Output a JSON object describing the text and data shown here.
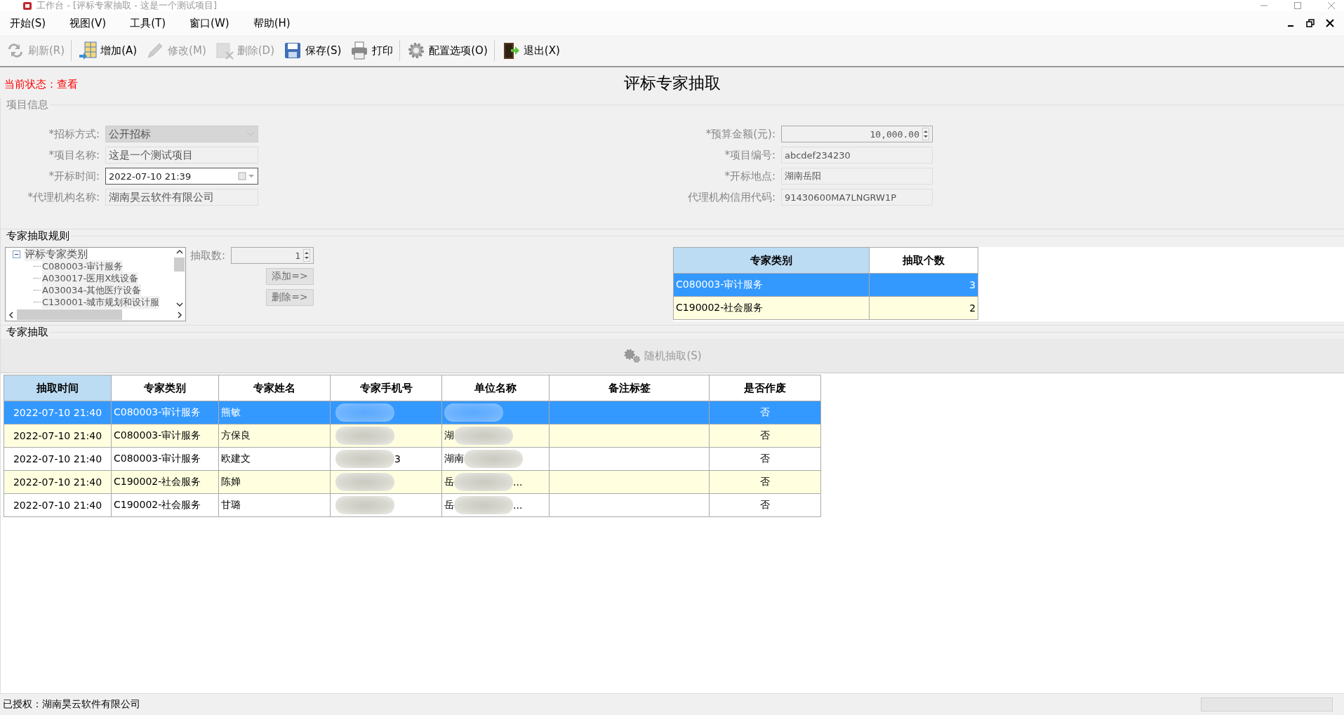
{
  "window": {
    "title": "工作台 - [评标专家抽取 - 这是一个测试项目]"
  },
  "menu": [
    "开始(S)",
    "视图(V)",
    "工具(T)",
    "窗口(W)",
    "帮助(H)"
  ],
  "toolbar": [
    {
      "kind": "refresh",
      "label": "刷新(R)",
      "disabled": true,
      "separator_after": true
    },
    {
      "kind": "add",
      "label": "增加(A)",
      "disabled": false,
      "separator_after": false
    },
    {
      "kind": "edit",
      "label": "修改(M)",
      "disabled": true,
      "separator_after": false
    },
    {
      "kind": "delete",
      "label": "删除(D)",
      "disabled": true,
      "separator_after": false
    },
    {
      "kind": "save",
      "label": "保存(S)",
      "disabled": false,
      "separator_after": false
    },
    {
      "kind": "print",
      "label": "打印",
      "disabled": false,
      "separator_after": true
    },
    {
      "kind": "settings",
      "label": "配置选项(O)",
      "disabled": false,
      "separator_after": true
    },
    {
      "kind": "exit",
      "label": "退出(X)",
      "disabled": false,
      "separator_after": false
    }
  ],
  "status": "当前状态：查看",
  "page_title": "评标专家抽取",
  "project_info": {
    "title": "项目信息",
    "left_fields": [
      {
        "label": "*招标方式:",
        "value": "公开招标",
        "kind": "combo",
        "disabled": true
      },
      {
        "label": "*项目名称:",
        "value": "这是一个测试项目",
        "kind": "text",
        "disabled": true
      },
      {
        "label": "*开标时间:",
        "value": "2022-07-10 21:39",
        "kind": "datetime",
        "disabled": false
      },
      {
        "label": "*代理机构名称:",
        "value": "湖南昊云软件有限公司",
        "kind": "text",
        "disabled": true
      }
    ],
    "right_fields": [
      {
        "label": "*预算金额(元):",
        "value": "10,000.00",
        "kind": "spin",
        "disabled": true
      },
      {
        "label": "*项目编号:",
        "value": "abcdef234230",
        "kind": "text",
        "disabled": true
      },
      {
        "label": "*开标地点:",
        "value": "湖南岳阳",
        "kind": "text",
        "disabled": true
      },
      {
        "label": "代理机构信用代码:",
        "value": "91430600MA7LNGRW1P",
        "kind": "text",
        "disabled": true
      }
    ]
  },
  "rules": {
    "title": "专家抽取规则",
    "tree": {
      "label": "评标专家类别",
      "expanded": true,
      "children": [
        {
          "label": "C080003-审计服务"
        },
        {
          "label": "A030017-医用X线设备"
        },
        {
          "label": "A030034-其他医疗设备"
        },
        {
          "label": "C130001-城市规划和设计服"
        }
      ]
    },
    "count_label": "抽取数:",
    "count_value": "1",
    "add_button": {
      "label": "添加=>",
      "disabled": true
    },
    "remove_button": {
      "label": "删除=>",
      "disabled": true
    },
    "grid": {
      "columns": [
        "专家类别",
        "抽取个数"
      ],
      "rows": [
        {
          "category": "C080003-审计服务",
          "count": "3",
          "selected": true
        },
        {
          "category": "C190002-社会服务",
          "count": "2",
          "selected": false
        }
      ]
    }
  },
  "extraction": {
    "title": "专家抽取",
    "button": {
      "label": "随机抽取(S)",
      "disabled": true
    },
    "columns": [
      "抽取时间",
      "专家类别",
      "专家姓名",
      "专家手机号",
      "单位名称",
      "备注标签",
      "是否作废"
    ],
    "rows": [
      {
        "selected": true,
        "time": "2022-07-10 21:40",
        "category": "C080003-审计服务",
        "name": "熊敏",
        "phone": {
          "blurred": true
        },
        "unit": {
          "blurred": true
        },
        "voided": "否"
      },
      {
        "selected": false,
        "time": "2022-07-10 21:40",
        "category": "C080003-审计服务",
        "name": "方保良",
        "phone": {
          "blurred": true
        },
        "unit": {
          "text": "湖",
          "blurred": true
        },
        "voided": "否"
      },
      {
        "selected": false,
        "time": "2022-07-10 21:40",
        "category": "C080003-审计服务",
        "name": "欧建文",
        "phone": {
          "blurred": true,
          "tail": "3"
        },
        "unit": {
          "text": "湖南",
          "blurred": true
        },
        "voided": "否"
      },
      {
        "selected": false,
        "time": "2022-07-10 21:40",
        "category": "C190002-社会服务",
        "name": "陈婵",
        "phone": {
          "blurred": true
        },
        "unit": {
          "text": "岳",
          "blurred": true,
          "tail": "..."
        },
        "voided": "否"
      },
      {
        "selected": false,
        "time": "2022-07-10 21:40",
        "category": "C190002-社会服务",
        "name": "甘璐",
        "phone": {
          "blurred": true
        },
        "unit": {
          "text": "岳",
          "blurred": true,
          "tail": "..."
        },
        "voided": "否"
      }
    ]
  },
  "status_bar": {
    "text": "已授权：湖南昊云软件有限公司"
  }
}
